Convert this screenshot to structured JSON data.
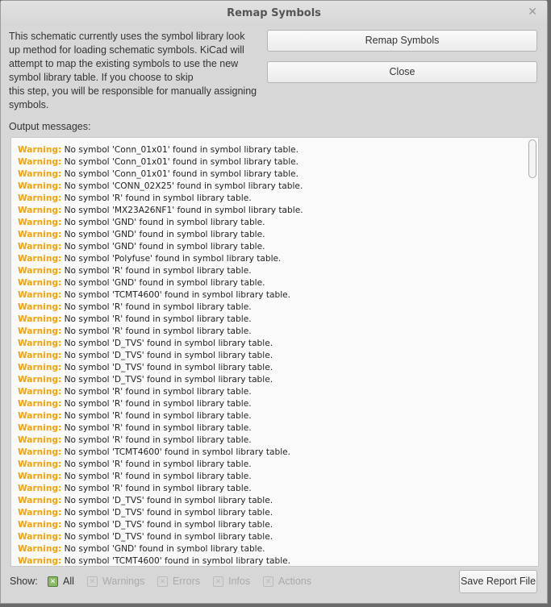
{
  "title": "Remap Symbols",
  "intro": "This schematic currently uses the symbol library look\nup method for loading schematic symbols.  KiCad will\nattempt to map the existing symbols to use the new\nsymbol library table.  If you choose to skip\nthis step, you will be responsible for manually assigning\nsymbols.",
  "buttons": {
    "remap": "Remap Symbols",
    "close": "Close",
    "save": "Save Report File"
  },
  "output_label": "Output messages:",
  "warning_prefix": "Warning:",
  "messages": [
    "No symbol 'Conn_01x01' found in symbol library table.",
    "No symbol 'Conn_01x01' found in symbol library table.",
    "No symbol 'Conn_01x01' found in symbol library table.",
    "No symbol 'CONN_02X25' found in symbol library table.",
    "No symbol 'R' found in symbol library table.",
    "No symbol 'MX23A26NF1' found in symbol library table.",
    "No symbol 'GND' found in symbol library table.",
    "No symbol 'GND' found in symbol library table.",
    "No symbol 'GND' found in symbol library table.",
    "No symbol 'Polyfuse' found in symbol library table.",
    "No symbol 'R' found in symbol library table.",
    "No symbol 'GND' found in symbol library table.",
    "No symbol 'TCMT4600' found in symbol library table.",
    "No symbol 'R' found in symbol library table.",
    "No symbol 'R' found in symbol library table.",
    "No symbol 'R' found in symbol library table.",
    "No symbol 'D_TVS' found in symbol library table.",
    "No symbol 'D_TVS' found in symbol library table.",
    "No symbol 'D_TVS' found in symbol library table.",
    "No symbol 'D_TVS' found in symbol library table.",
    "No symbol 'R' found in symbol library table.",
    "No symbol 'R' found in symbol library table.",
    "No symbol 'R' found in symbol library table.",
    "No symbol 'R' found in symbol library table.",
    "No symbol 'R' found in symbol library table.",
    "No symbol 'TCMT4600' found in symbol library table.",
    "No symbol 'R' found in symbol library table.",
    "No symbol 'R' found in symbol library table.",
    "No symbol 'R' found in symbol library table.",
    "No symbol 'D_TVS' found in symbol library table.",
    "No symbol 'D_TVS' found in symbol library table.",
    "No symbol 'D_TVS' found in symbol library table.",
    "No symbol 'D_TVS' found in symbol library table.",
    "No symbol 'GND' found in symbol library table.",
    "No symbol 'TCMT4600' found in symbol library table."
  ],
  "show_label": "Show:",
  "filters": [
    {
      "label": "All",
      "checked": true
    },
    {
      "label": "Warnings",
      "checked": false
    },
    {
      "label": "Errors",
      "checked": false
    },
    {
      "label": "Infos",
      "checked": false
    },
    {
      "label": "Actions",
      "checked": false
    }
  ]
}
